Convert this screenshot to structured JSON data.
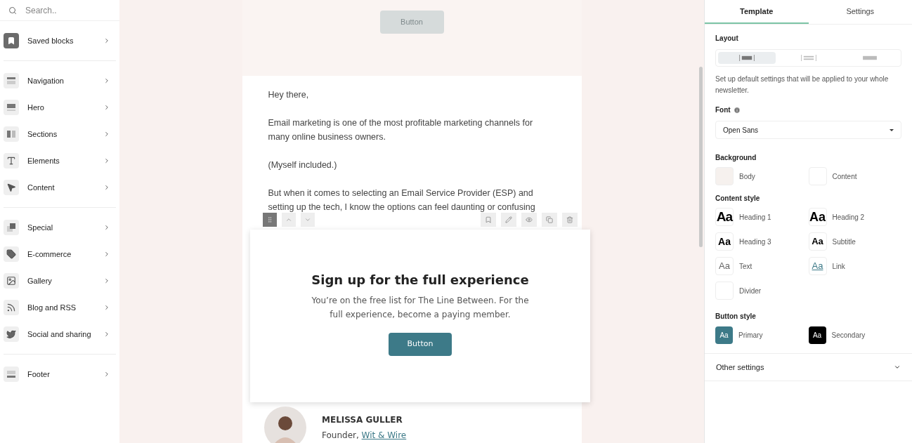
{
  "sidebar": {
    "search": {
      "placeholder": "Search.."
    },
    "groups": [
      [
        {
          "label": "Saved blocks",
          "kind": "bookmark"
        }
      ],
      [
        {
          "label": "Navigation",
          "kind": "navigation"
        },
        {
          "label": "Hero",
          "kind": "hero"
        },
        {
          "label": "Sections",
          "kind": "sections"
        },
        {
          "label": "Elements",
          "kind": "text"
        },
        {
          "label": "Content",
          "kind": "pointer"
        }
      ],
      [
        {
          "label": "Special",
          "kind": "special"
        },
        {
          "label": "E-commerce",
          "kind": "tag"
        },
        {
          "label": "Gallery",
          "kind": "image"
        },
        {
          "label": "Blog and RSS",
          "kind": "rss"
        },
        {
          "label": "Social and sharing",
          "kind": "bird"
        }
      ],
      [
        {
          "label": "Footer",
          "kind": "footer"
        }
      ]
    ]
  },
  "email": {
    "top_button": {
      "label": "Button",
      "disabled": true
    },
    "paragraphs": [
      "Hey there,",
      "Email marketing is one of the most profitable marketing channels for many online business owners.",
      "(Myself included.)",
      "But when it comes to selecting an Email Service Provider (ESP) and setting up the tech, I know the options can feel daunting or confusing"
    ],
    "popup": {
      "title": "Sign up for the full experience",
      "text": "You’re on the free list for The Line Between. For the full experience, become a paying member.",
      "button": "Button"
    },
    "author": {
      "name": "MELISSA GULLER",
      "role": "Founder, ",
      "company": "Wit & Wire"
    }
  },
  "panel": {
    "tabs": [
      {
        "label": "Template",
        "selected": true
      },
      {
        "label": "Settings",
        "selected": false
      }
    ],
    "layout": {
      "title": "Layout",
      "options": [
        {
          "kind": "boxed",
          "selected": true
        },
        {
          "kind": "lines",
          "selected": false
        },
        {
          "kind": "full",
          "selected": false
        }
      ]
    },
    "description": "Set up default settings that will be applied to your whole newsletter.",
    "font": {
      "label": "Font",
      "value": "Open Sans"
    },
    "background": {
      "title": "Background",
      "items": [
        {
          "label": "Body",
          "color": "#f6f1ee"
        },
        {
          "label": "Content",
          "color": "#ffffff"
        }
      ]
    },
    "content_style": {
      "title": "Content style",
      "items": [
        {
          "label": "Heading 1",
          "kind": "h1",
          "sample": "Aa"
        },
        {
          "label": "Heading 2",
          "kind": "h2",
          "sample": "Aa"
        },
        {
          "label": "Heading 3",
          "kind": "h3",
          "sample": "Aa"
        },
        {
          "label": "Subtitle",
          "kind": "subtitle",
          "sample": "Aa"
        },
        {
          "label": "Text",
          "kind": "text",
          "sample": "Aa"
        },
        {
          "label": "Link",
          "kind": "link",
          "sample": "Aa"
        },
        {
          "label": "Divider",
          "kind": "divider"
        }
      ]
    },
    "button_style": {
      "title": "Button style",
      "items": [
        {
          "label": "Primary",
          "sample": "Aa",
          "color": "#3d7a88"
        },
        {
          "label": "Secondary",
          "sample": "Aa",
          "color": "#000000"
        }
      ]
    },
    "other": {
      "label": "Other settings",
      "expanded": false
    }
  }
}
